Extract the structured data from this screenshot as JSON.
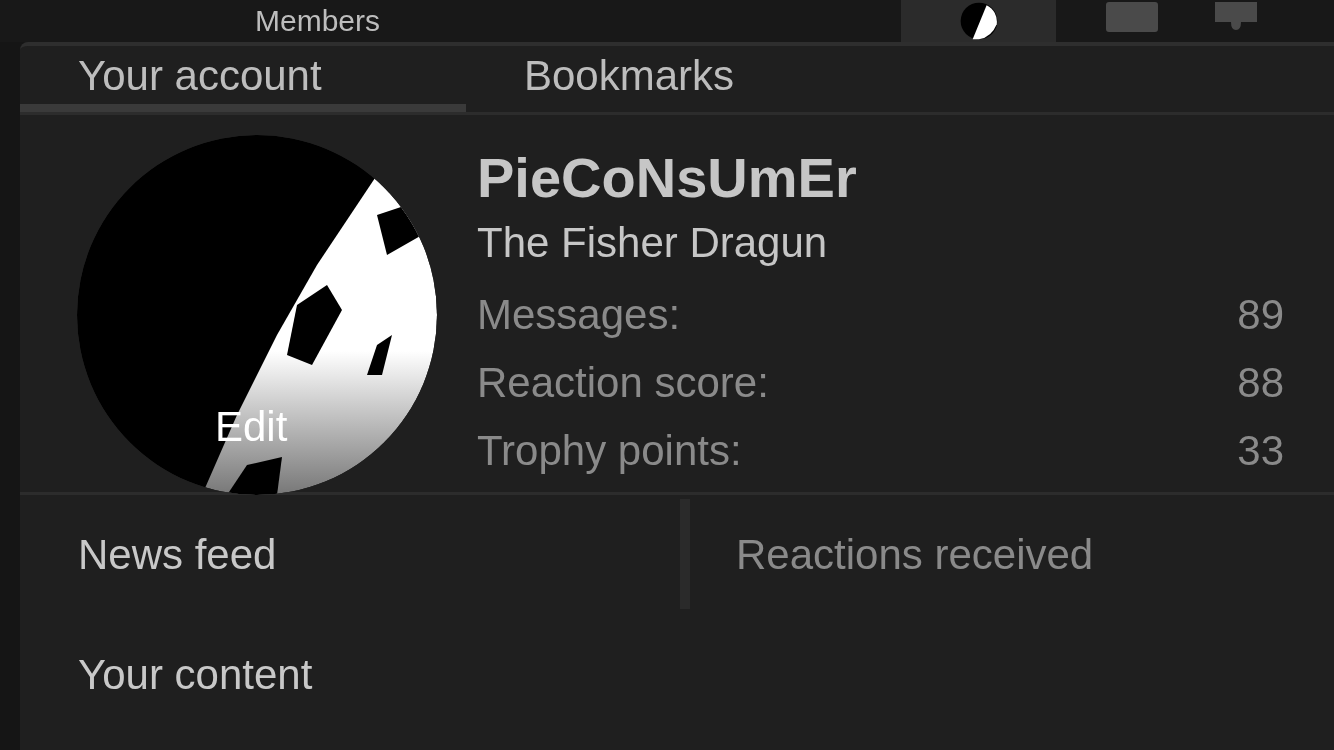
{
  "nav": {
    "items": [
      {
        "label": "Members"
      }
    ]
  },
  "account_menu": {
    "tabs": [
      {
        "label": "Your account",
        "selected": true
      },
      {
        "label": "Bookmarks",
        "selected": false
      }
    ],
    "avatar": {
      "edit_label": "Edit"
    },
    "username": "PieCoNsUmEr",
    "user_title": "The Fisher Dragun",
    "stats": [
      {
        "label": "Messages:",
        "value": "89"
      },
      {
        "label": "Reaction score:",
        "value": "88"
      },
      {
        "label": "Trophy points:",
        "value": "33"
      }
    ],
    "links": [
      {
        "label": "News feed",
        "kind": "primary"
      },
      {
        "label": "Reactions received",
        "kind": "secondary"
      },
      {
        "label": "Your content",
        "kind": "primary"
      }
    ]
  }
}
